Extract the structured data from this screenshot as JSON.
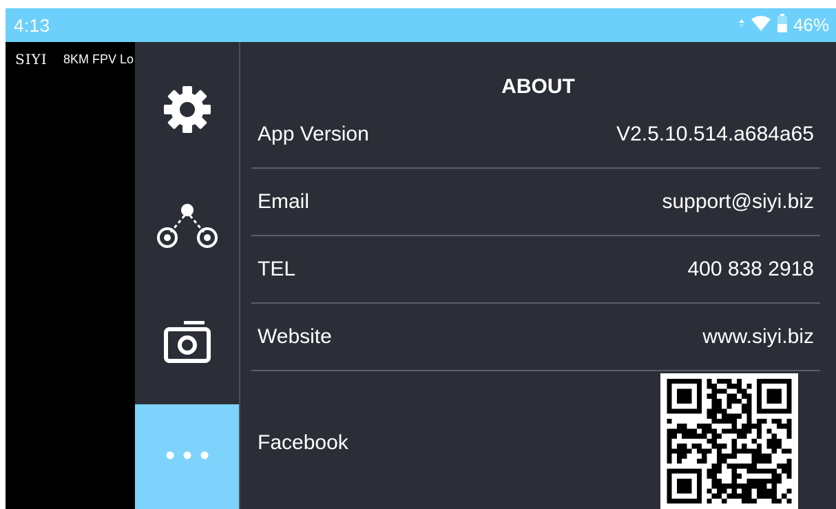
{
  "status_bar": {
    "time": "4:13",
    "battery_percent": "46%",
    "icons": [
      "data-arrows-icon",
      "wifi-icon",
      "battery-icon"
    ]
  },
  "video": {
    "brand": "SIYI",
    "product_name": "8KM FPV Lo"
  },
  "side_nav": {
    "items": [
      {
        "icon": "gear-icon",
        "active": false
      },
      {
        "icon": "link-nodes-icon",
        "active": false
      },
      {
        "icon": "camera-icon",
        "active": false
      },
      {
        "icon": "more-dots-icon",
        "active": true
      }
    ]
  },
  "about": {
    "title": "ABOUT",
    "rows": [
      {
        "label": "App Version",
        "value": "V2.5.10.514.a684a65"
      },
      {
        "label": "Email",
        "value": "support@siyi.biz"
      },
      {
        "label": "TEL",
        "value": "400 838 2918"
      },
      {
        "label": "Website",
        "value": "www.siyi.biz"
      }
    ],
    "facebook_label": "Facebook"
  },
  "colors": {
    "status_bar": "#6cd0fb",
    "panel_bg": "#2b2e36",
    "active_nav": "#7dd3fb",
    "divider": "#5a5e68"
  }
}
